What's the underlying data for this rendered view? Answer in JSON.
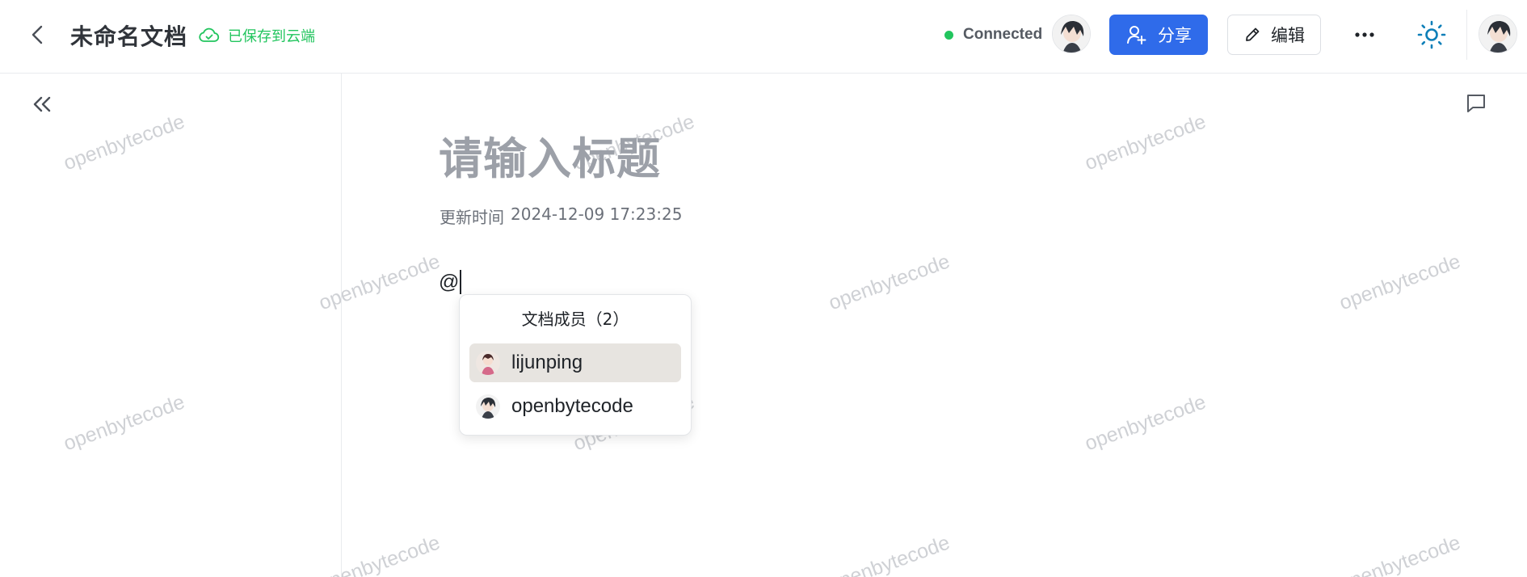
{
  "header": {
    "document_title": "未命名文档",
    "save_status": "已保存到云端",
    "connection_status": "Connected",
    "share_label": "分享",
    "edit_label": "编辑"
  },
  "document": {
    "title_placeholder": "请输入标题",
    "updated_label": "更新时间",
    "updated_time": "2024-12-09 17:23:25",
    "editor_text": "@"
  },
  "mention_popup": {
    "header": "文档成员（2）",
    "members": [
      {
        "name": "lijunping",
        "highlighted": true
      },
      {
        "name": "openbytecode",
        "highlighted": false
      }
    ]
  },
  "watermark_text": "openbytecode",
  "colors": {
    "accent": "#2f6bea",
    "connected_green": "#22c55e",
    "highlight": "#e7e4e0"
  }
}
